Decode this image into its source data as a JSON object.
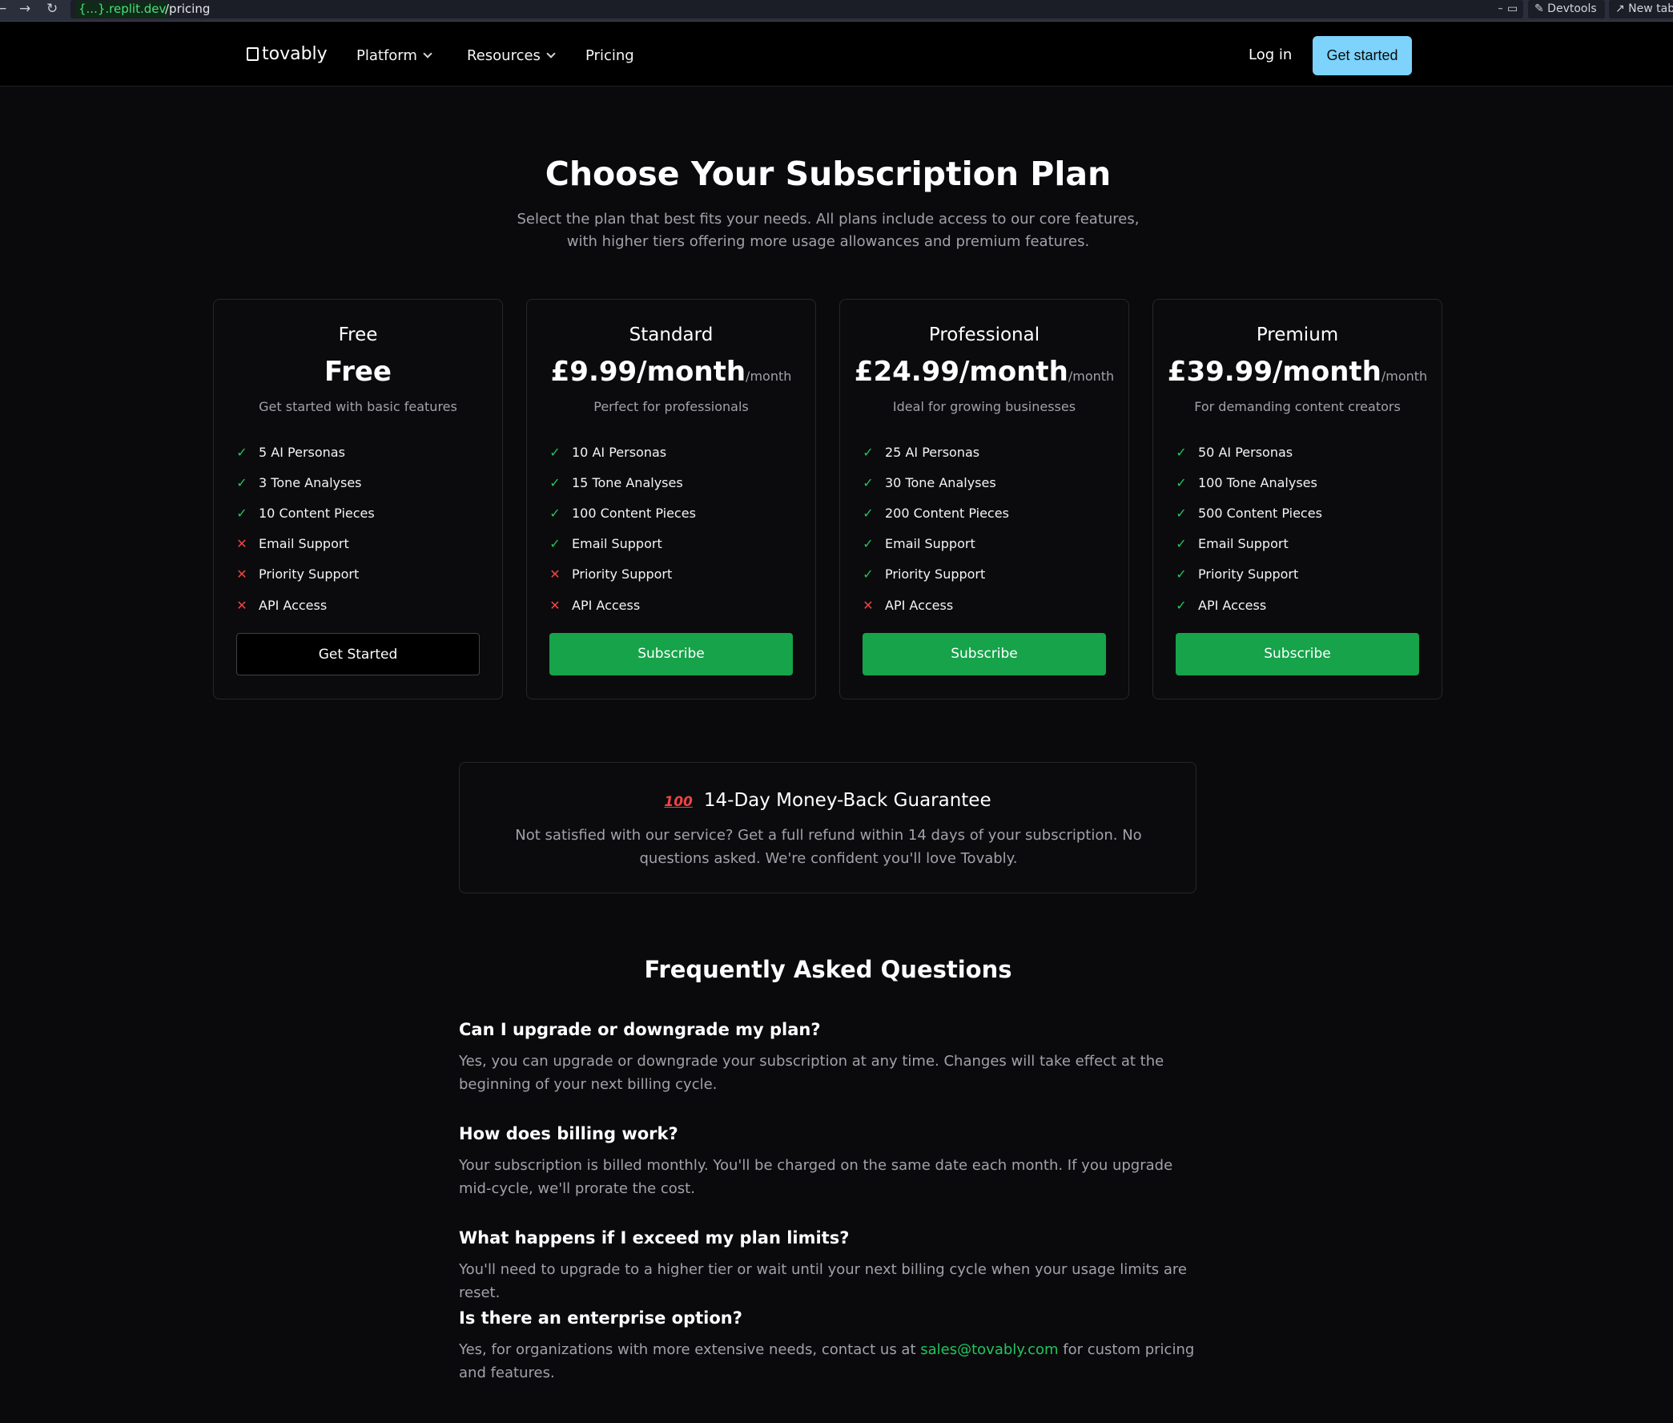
{
  "browser": {
    "back_glyph": "←",
    "forward_glyph": "→",
    "reload_glyph": "↻",
    "url_domain": "{...}.replit.dev",
    "url_path": "/pricing",
    "go_glyph": "→",
    "screen_glyph": "▭",
    "devtools_label": "✎ Devtools",
    "newtab_label": "↗ New tab"
  },
  "header": {
    "logo": "tovably",
    "nav": [
      "Platform",
      "Resources",
      "Pricing"
    ],
    "login": "Log in",
    "cta": "Get started"
  },
  "hero": {
    "title": "Choose Your Subscription Plan",
    "subtitle": "Select the plan that best fits your needs. All plans include access to our core features, with higher tiers offering more usage allowances and premium features."
  },
  "plans": [
    {
      "name": "Free",
      "price": "Free",
      "per": "",
      "desc": "Get started with basic features",
      "features": [
        "5 AI Personas",
        "3 Tone Analyses",
        "10 Content Pieces",
        "Email Support",
        "Priority Support",
        "API Access"
      ],
      "included": [
        true,
        true,
        true,
        false,
        false,
        false
      ],
      "button": "Get Started"
    },
    {
      "name": "Standard",
      "price": "£9.99/month",
      "per": "/month",
      "desc": "Perfect for professionals",
      "features": [
        "10 AI Personas",
        "15 Tone Analyses",
        "100 Content Pieces",
        "Email Support",
        "Priority Support",
        "API Access"
      ],
      "included": [
        true,
        true,
        true,
        true,
        false,
        false
      ],
      "button": "Subscribe"
    },
    {
      "name": "Professional",
      "price": "£24.99/month",
      "per": "/month",
      "desc": "Ideal for growing businesses",
      "features": [
        "25 AI Personas",
        "30 Tone Analyses",
        "200 Content Pieces",
        "Email Support",
        "Priority Support",
        "API Access"
      ],
      "included": [
        true,
        true,
        true,
        true,
        true,
        false
      ],
      "button": "Subscribe"
    },
    {
      "name": "Premium",
      "price": "£39.99/month",
      "per": "/month",
      "desc": "For demanding content creators",
      "features": [
        "50 AI Personas",
        "100 Tone Analyses",
        "500 Content Pieces",
        "Email Support",
        "Priority Support",
        "API Access"
      ],
      "included": [
        true,
        true,
        true,
        true,
        true,
        true
      ],
      "button": "Subscribe"
    }
  ],
  "guarantee": {
    "icon_text": "100",
    "title": "14-Day Money-Back Guarantee",
    "text": "Not satisfied with our service? Get a full refund within 14 days of your subscription. No questions asked. We're confident you'll love Tovably."
  },
  "faq": {
    "title": "Frequently Asked Questions",
    "items": [
      {
        "q": "Can I upgrade or downgrade my plan?",
        "a": "Yes, you can upgrade or downgrade your subscription at any time. Changes will take effect at the beginning of your next billing cycle."
      },
      {
        "q": "How does billing work?",
        "a": "Your subscription is billed monthly. You'll be charged on the same date each month. If you upgrade mid-cycle, we'll prorate the cost."
      },
      {
        "q": "What happens if I exceed my plan limits?",
        "a": "You'll need to upgrade to a higher tier or wait until your next billing cycle when your usage limits are reset."
      },
      {
        "q": "Is there an enterprise option?",
        "a_before": "Yes, for organizations with more extensive needs, contact us at ",
        "a_link": "sales@tovably.com",
        "a_after": " for custom pricing and features."
      }
    ]
  },
  "colors": {
    "background": "#0a0a0c",
    "accent_green": "#16a34a",
    "cta_blue": "#7dd3fc",
    "check": "#22c55e",
    "cross": "#ef4444"
  },
  "icons": {
    "check": "check-icon",
    "cross": "x-icon",
    "chevron": "chevron-down-icon",
    "guarantee": "hundred-points-icon"
  }
}
